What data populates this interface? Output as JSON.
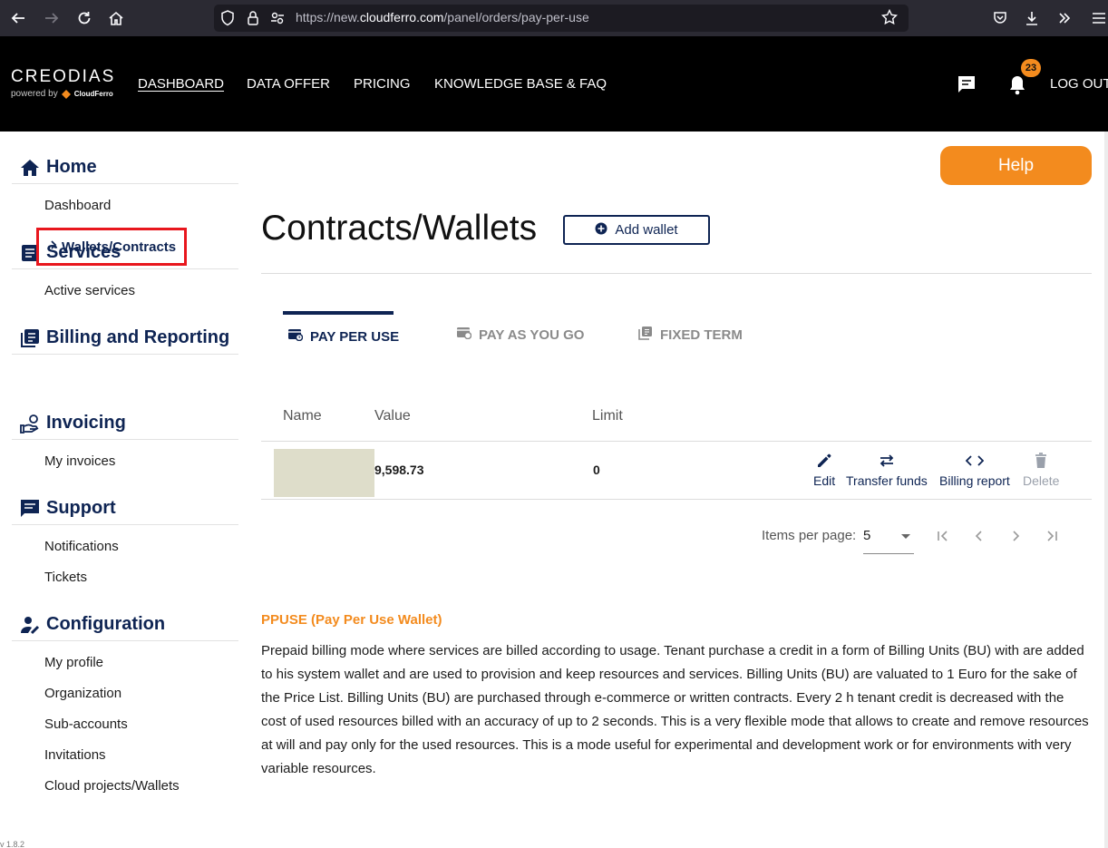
{
  "browser": {
    "url_prefix": "https://new.",
    "url_host": "cloudferro.com",
    "url_path": "/panel/orders/pay-per-use"
  },
  "header": {
    "logo_text": "CREODIAS",
    "logo_powered": "powered by",
    "logo_brand": "CloudFerro",
    "nav": [
      "DASHBOARD",
      "DATA OFFER",
      "PRICING",
      "KNOWLEDGE BASE & FAQ"
    ],
    "notifications_count": "23",
    "logout_label": "LOG OUT"
  },
  "sidebar": {
    "sections": [
      {
        "title": "Home",
        "icon": "home-icon",
        "items": [
          "Dashboard"
        ]
      },
      {
        "title": "Services",
        "icon": "services-icon",
        "items": [
          "Active services"
        ]
      },
      {
        "title": "Billing and Reporting",
        "icon": "billing-icon",
        "items": [
          "Wallets/Contracts"
        ]
      },
      {
        "title": "Invoicing",
        "icon": "invoicing-icon",
        "items": [
          "My invoices"
        ]
      },
      {
        "title": "Support",
        "icon": "support-icon",
        "items": [
          "Notifications",
          "Tickets"
        ]
      },
      {
        "title": "Configuration",
        "icon": "configuration-icon",
        "items": [
          "My profile",
          "Organization",
          "Sub-accounts",
          "Invitations",
          "Cloud projects/Wallets"
        ]
      }
    ],
    "version": "v 1.8.2"
  },
  "main": {
    "help_label": "Help",
    "title": "Contracts/Wallets",
    "add_wallet_label": "Add wallet",
    "tabs": [
      "PAY PER USE",
      "PAY AS YOU GO",
      "FIXED TERM"
    ],
    "table": {
      "headers": [
        "Name",
        "Value",
        "Limit"
      ],
      "rows": [
        {
          "name": "",
          "value": "9,598.73",
          "limit": "0"
        }
      ],
      "actions": [
        "Edit",
        "Transfer funds",
        "Billing report",
        "Delete"
      ]
    },
    "pager": {
      "label": "Items per page:",
      "value": "5"
    },
    "description": {
      "title": "PPUSE (Pay Per Use Wallet)",
      "body": "Prepaid billing mode where services are billed according to usage. Tenant purchase a credit in a form of Billing Units (BU) with are added to his system wallet and are used to provision and keep resources and services. Billing Units (BU) are valuated to 1 Euro for the sake of the Price List. Billing Units (BU) are purchased through e-commerce or written contracts. Every 2 h tenant credit is decreased with the cost of used resources billed with an accuracy of up to 2 seconds. This is a very flexible mode that allows to create and remove resources at will and pay only for the used resources. This is a mode useful for experimental and development work or for environments with very variable resources."
    }
  },
  "colors": {
    "accent": "#f38b1e",
    "navy": "#0e2453",
    "highlight_border": "#e8161d"
  }
}
